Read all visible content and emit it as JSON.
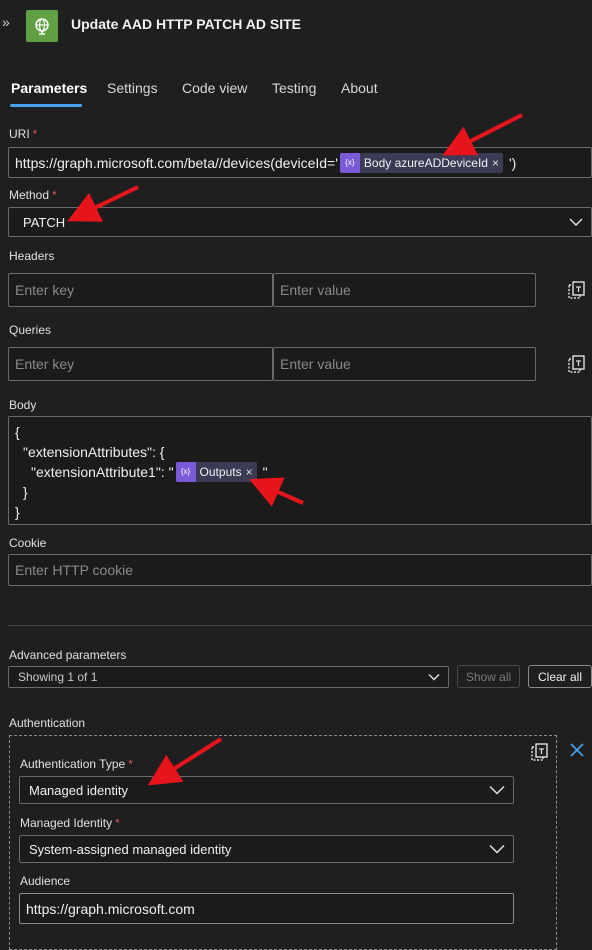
{
  "header": {
    "title": "Update AAD HTTP PATCH AD SITE",
    "collapse_glyph": "»"
  },
  "tabs": [
    "Parameters",
    "Settings",
    "Code view",
    "Testing",
    "About"
  ],
  "uri": {
    "label": "URI",
    "required": "*",
    "prefix": "https://graph.microsoft.com/beta//devices(deviceId='",
    "token": "Body azureADDeviceId",
    "suffix": "')"
  },
  "method": {
    "label": "Method",
    "required": "*",
    "value": "PATCH"
  },
  "headers": {
    "label": "Headers",
    "key_placeholder": "Enter key",
    "value_placeholder": "Enter value"
  },
  "queries": {
    "label": "Queries",
    "key_placeholder": "Enter key",
    "value_placeholder": "Enter value"
  },
  "body": {
    "label": "Body",
    "line1": "{",
    "line2": "\"extensionAttributes\": {",
    "line3_prefix": "\"extensionAttribute1\": \"",
    "line3_token": "Outputs",
    "line3_suffix": "\"",
    "line4": "}",
    "line5": "}"
  },
  "cookie": {
    "label": "Cookie",
    "placeholder": "Enter HTTP cookie"
  },
  "advanced": {
    "label": "Advanced parameters",
    "showing": "Showing 1 of 1",
    "show_all": "Show all",
    "clear_all": "Clear all"
  },
  "authentication": {
    "label": "Authentication",
    "type_label": "Authentication Type",
    "type_required": "*",
    "type_value": "Managed identity",
    "identity_label": "Managed Identity",
    "identity_required": "*",
    "identity_value": "System-assigned managed identity",
    "audience_label": "Audience",
    "audience_value": "https://graph.microsoft.com"
  },
  "token_icon_text": "{x}",
  "token_close": "×",
  "colors": {
    "accent": "#4aa3f0",
    "required": "#e0535f",
    "annotation_arrow": "#e8141c",
    "action_icon": "#61a042",
    "token": "#7a5ad8"
  }
}
